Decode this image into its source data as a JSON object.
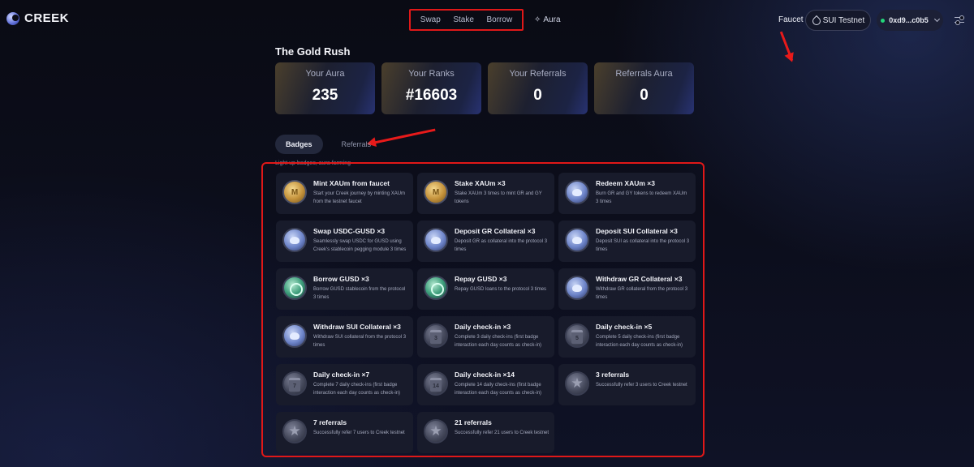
{
  "header": {
    "logo_text": "CREEK",
    "nav": [
      "Swap",
      "Stake",
      "Borrow"
    ],
    "aura_label": "Aura",
    "faucet_label": "Faucet",
    "network_label": "SUI Testnet",
    "wallet_label": "0xd9...c0b5"
  },
  "page": {
    "title": "The Gold Rush",
    "stats": [
      {
        "label": "Your Aura",
        "value": "235"
      },
      {
        "label": "Your Ranks",
        "value": "#16603"
      },
      {
        "label": "Your Referrals",
        "value": "0"
      },
      {
        "label": "Referrals Aura",
        "value": "0"
      }
    ],
    "tabs": [
      "Badges",
      "Referrals"
    ],
    "subtitle": "Light up badges, aura farming"
  },
  "badges": [
    {
      "title": "Mint XAUm from faucet",
      "desc": "Start your Creek journey by minting XAUm from the testnet faucet",
      "icon": "gold-coin-icon"
    },
    {
      "title": "Stake XAUm ×3",
      "desc": "Stake XAUm 3 times to mint GR and GY tokens",
      "icon": "gold-coin-icon"
    },
    {
      "title": "Redeem XAUm ×3",
      "desc": "Burn GR and GY tokens to redeem XAUm 3 times",
      "icon": "piggy-bank-icon"
    },
    {
      "title": "Swap USDC-GUSD ×3",
      "desc": "Seamlessly swap USDC for GUSD using Creek's stablecoin pegging module 3 times",
      "icon": "swap-coins-icon"
    },
    {
      "title": "Deposit GR Collateral ×3",
      "desc": "Deposit GR as collateral into the protocol 3 times",
      "icon": "piggy-bank-icon"
    },
    {
      "title": "Deposit SUI Collateral ×3",
      "desc": "Deposit SUI as collateral into the protocol 3 times",
      "icon": "piggy-bank-icon"
    },
    {
      "title": "Borrow GUSD ×3",
      "desc": "Borrow GUSD stablecoin from the protocol 3 times",
      "icon": "hand-coins-icon"
    },
    {
      "title": "Repay GUSD ×3",
      "desc": "Repay GUSD loans to the protocol 3 times",
      "icon": "coins-stack-icon"
    },
    {
      "title": "Withdraw GR Collateral ×3",
      "desc": "Withdraw GR collateral from the protocol 3 times",
      "icon": "withdraw-icon"
    },
    {
      "title": "Withdraw SUI Collateral ×3",
      "desc": "Withdraw SUI collateral from the protocol 3 times",
      "icon": "withdraw-icon"
    },
    {
      "title": "Daily check-in ×3",
      "desc": "Complete 3 daily check-ins (first badge interaction each day counts as check-in)",
      "icon": "calendar-icon",
      "num": "3"
    },
    {
      "title": "Daily check-in ×5",
      "desc": "Complete 5 daily check-ins (first badge interaction each day counts as check-in)",
      "icon": "calendar-icon",
      "num": "5"
    },
    {
      "title": "Daily check-in ×7",
      "desc": "Complete 7 daily check-ins (first badge interaction each day counts as check-in)",
      "icon": "calendar-icon",
      "num": "7"
    },
    {
      "title": "Daily check-in ×14",
      "desc": "Complete 14 daily check-ins (first badge interaction each day counts as check-in)",
      "icon": "calendar-icon",
      "num": "14"
    },
    {
      "title": "3 referrals",
      "desc": "Successfully refer 3 users to Creek testnet",
      "icon": "star-icon"
    },
    {
      "title": "7 referrals",
      "desc": "Successfully refer 7 users to Creek testnet",
      "icon": "star-icon"
    },
    {
      "title": "21 referrals",
      "desc": "Successfully refer 21 users to Creek testnet",
      "icon": "star-icon"
    }
  ],
  "colors": {
    "annotation_red": "#e01818",
    "accent_green": "#23d67a"
  }
}
